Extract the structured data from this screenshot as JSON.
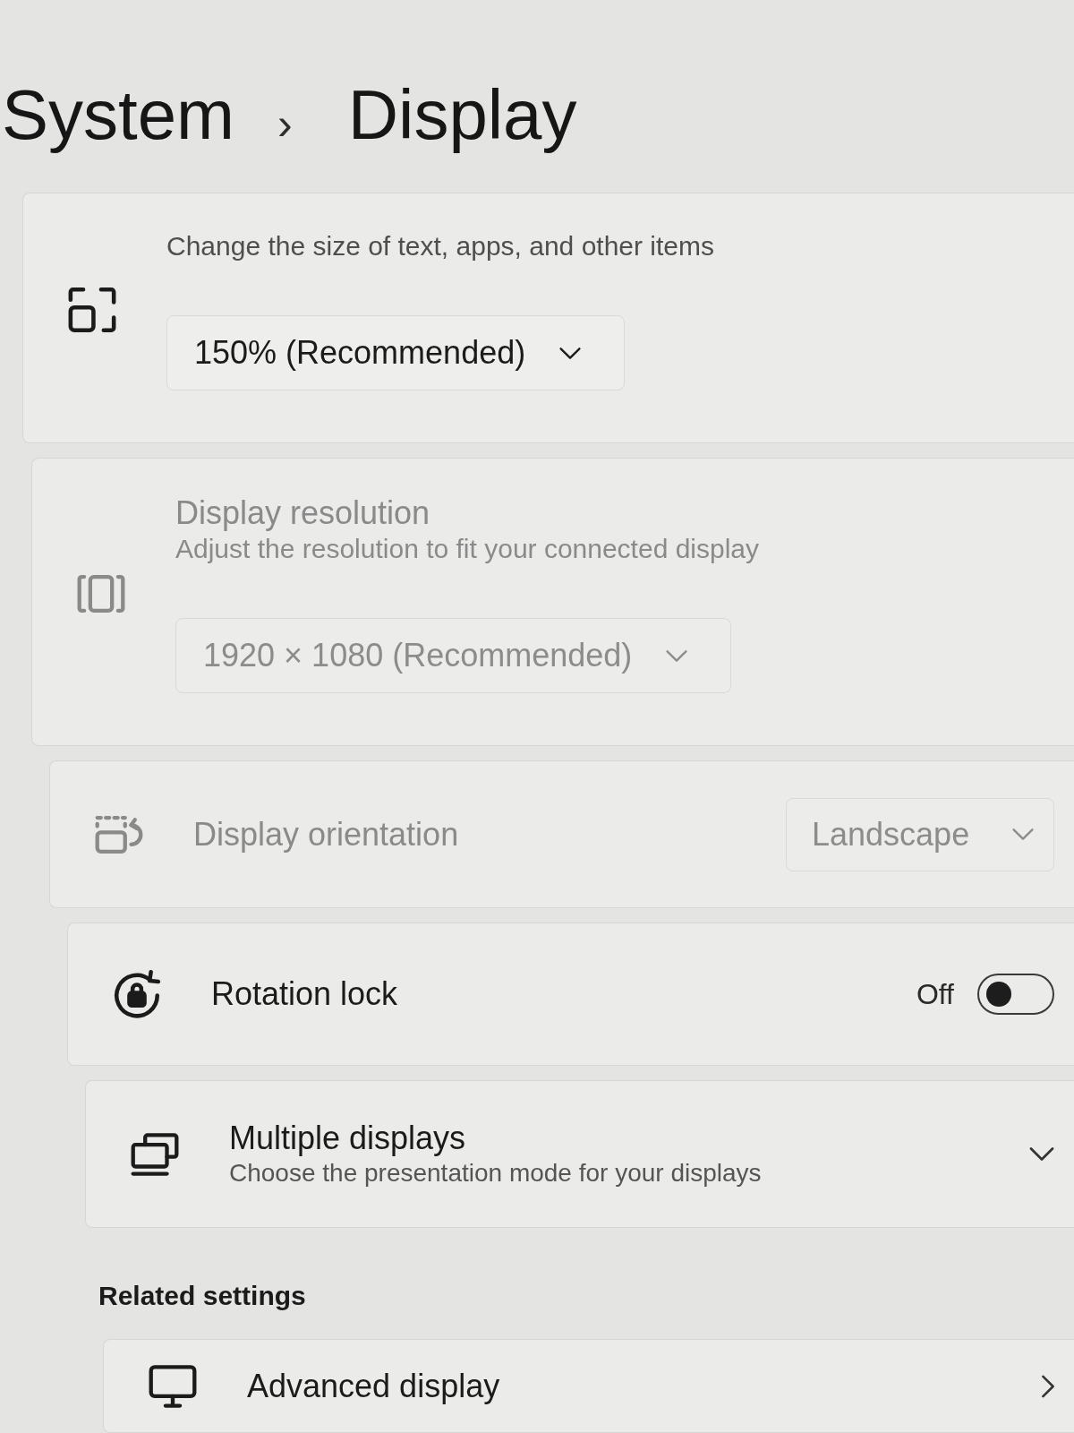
{
  "header": {
    "parent": "System",
    "separator": "›",
    "current": "Display"
  },
  "cards": [
    {
      "kind": "stacked",
      "description": "Change the size of text, apps, and other items",
      "dropdown": "150% (Recommended)",
      "disabled": false
    },
    {
      "kind": "stacked",
      "title": "Display resolution",
      "description": "Adjust the resolution to fit your connected display",
      "dropdown": "1920 × 1080 (Recommended)",
      "disabled": true
    },
    {
      "kind": "inline",
      "title": "Display orientation",
      "dropdown": "Landscape",
      "disabled": true
    },
    {
      "kind": "toggle",
      "title": "Rotation lock",
      "state_label": "Off",
      "on": false
    },
    {
      "kind": "expander",
      "title": "Multiple displays",
      "description": "Choose the presentation mode for your displays",
      "expanded": false
    }
  ],
  "related": {
    "heading": "Related settings",
    "cards": [
      {
        "kind": "link",
        "title": "Advanced display"
      }
    ]
  }
}
